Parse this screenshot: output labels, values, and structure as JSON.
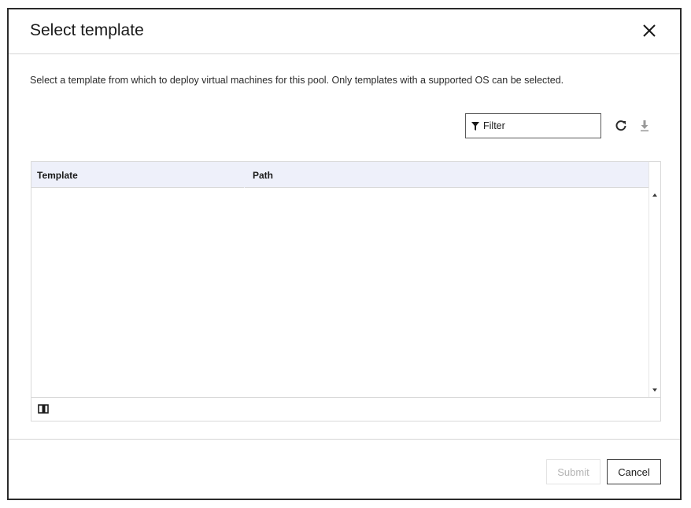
{
  "dialog": {
    "title": "Select template",
    "description": "Select a template from which to deploy virtual machines for this pool. Only templates with a supported OS can be selected."
  },
  "toolbar": {
    "filter_placeholder": "Filter",
    "refresh_icon": "refresh-icon",
    "export_icon": "download-icon"
  },
  "grid": {
    "columns": [
      "Template",
      "Path"
    ],
    "rows": []
  },
  "footer": {
    "submit_label": "Submit",
    "cancel_label": "Cancel",
    "submit_enabled": false
  }
}
